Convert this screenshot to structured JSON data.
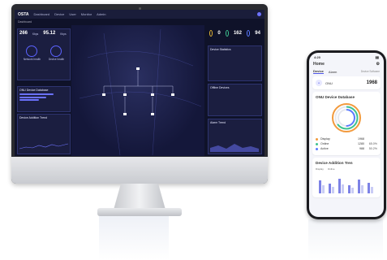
{
  "desktop": {
    "brand": "OSTA",
    "nav": [
      "Dashboard",
      "Device",
      "User",
      "Monitor",
      "Admin"
    ],
    "breadcrumb": "Dashboard",
    "top_stats": [
      {
        "value": "0",
        "label": "Offline"
      },
      {
        "value": "162",
        "label": "Online"
      },
      {
        "value": "94",
        "label": "Active"
      }
    ],
    "left_stats": [
      {
        "value": "266",
        "unit": "Kbps"
      },
      {
        "value": "95.12",
        "unit": "Kbps"
      }
    ],
    "left_gauges": [
      "Network health",
      "Device health"
    ],
    "left_panel_title": "ONU Device Database",
    "left_chart_title": "Device Addition Trend",
    "right_panel_titles": [
      "Device Statistics",
      "Offline Devices",
      "Alarm Trend"
    ]
  },
  "phone": {
    "time": "4:20",
    "title": "Home",
    "tabs": [
      "Device",
      "Alarm"
    ],
    "filter": "Device Software",
    "onu_label": "ONU",
    "onu_count": "1968",
    "database_title": "ONU Device Database",
    "legend": [
      {
        "name": "Display",
        "value": "1968",
        "pct": "",
        "color": "#f29a3d"
      },
      {
        "name": "Online",
        "value": "1280",
        "pct": "65.0%",
        "color": "#3ec28f"
      },
      {
        "name": "Active",
        "value": "988",
        "pct": "50.2%",
        "color": "#5b7bff"
      }
    ],
    "trend_title": "Device Addition Tren",
    "trend_legend": [
      "Display",
      "Online"
    ]
  }
}
